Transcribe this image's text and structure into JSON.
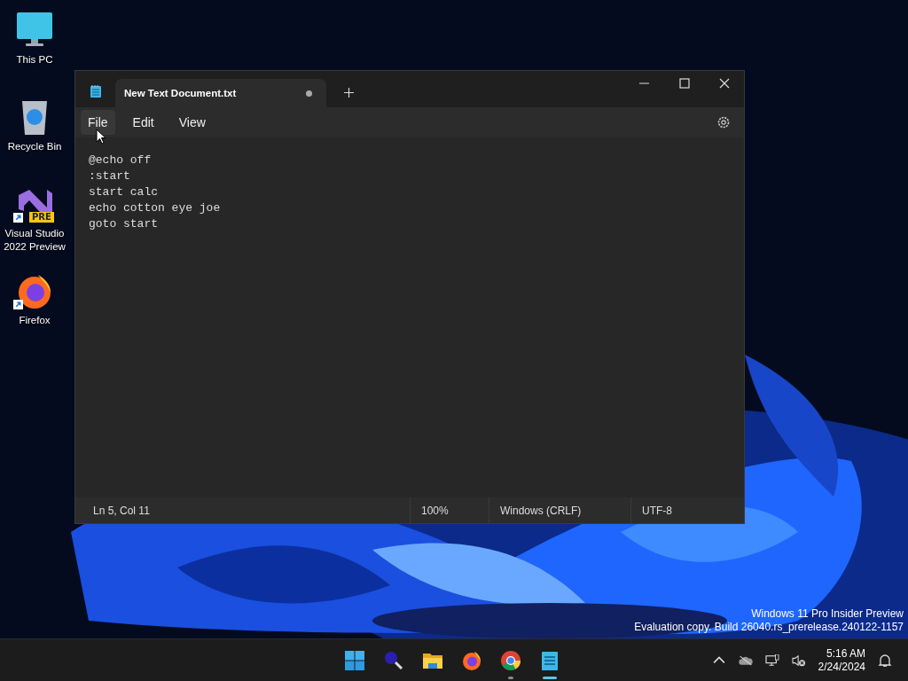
{
  "desktop_icons": [
    {
      "label": "This PC",
      "kind": "monitor",
      "shortcut": false
    },
    {
      "label": "Recycle Bin",
      "kind": "bin",
      "shortcut": false
    },
    {
      "label": "Visual Studio 2022 Preview",
      "kind": "vs",
      "badge": "PRE",
      "shortcut": true
    },
    {
      "label": "Firefox",
      "kind": "firefox",
      "shortcut": true
    }
  ],
  "window": {
    "tabs": [
      {
        "title": "New Text Document.txt",
        "selected": true,
        "unsaved": true
      }
    ],
    "menu": [
      {
        "label": "File",
        "hovered": true
      },
      {
        "label": "Edit",
        "hovered": false
      },
      {
        "label": "View",
        "hovered": false
      }
    ],
    "lines": [
      "@echo off",
      ":start",
      "start calc",
      "echo cotton eye joe",
      "goto start"
    ],
    "status_bar": {
      "position": "Ln 5, Col 11",
      "zoom": "100%",
      "line_ending": "Windows (CRLF)",
      "encoding": "UTF-8"
    }
  },
  "edition_notice": [
    "Windows 11 Pro Insider Preview",
    "Evaluation copy. Build 26040.rs_prerelease.240122-1157"
  ],
  "taskbar": {
    "apps": [
      {
        "kind": "start",
        "running": false,
        "active": false
      },
      {
        "kind": "search",
        "running": false,
        "active": false
      },
      {
        "kind": "explorer",
        "running": false,
        "active": false
      },
      {
        "kind": "firefox",
        "running": false,
        "active": false
      },
      {
        "kind": "chrome",
        "running": true,
        "active": false
      },
      {
        "kind": "notepad",
        "running": true,
        "active": true
      }
    ],
    "time": "5:16 AM",
    "date": "2/24/2024"
  }
}
